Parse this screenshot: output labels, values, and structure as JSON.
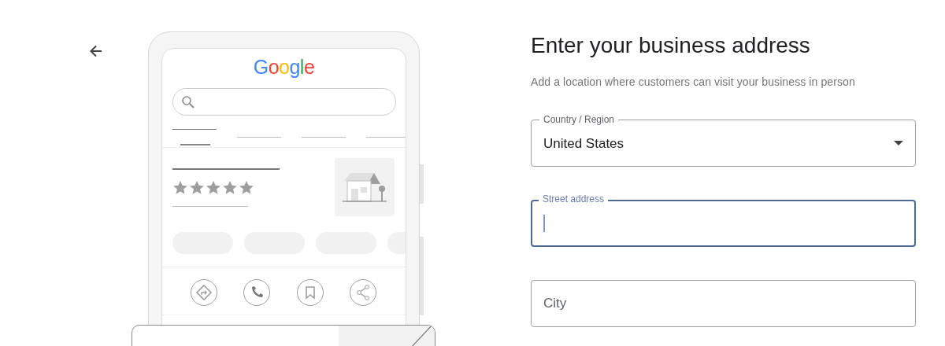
{
  "preview": {
    "logo": "Google"
  },
  "form": {
    "title": "Enter your business address",
    "subtitle": "Add a location where customers can visit your business in person",
    "fields": [
      {
        "kind": "select",
        "label": "Country / Region",
        "value": "United States",
        "focused": false
      },
      {
        "kind": "text",
        "label": "Street address",
        "focused": true
      },
      {
        "kind": "text",
        "placeholder": "City",
        "focused": false
      }
    ]
  }
}
